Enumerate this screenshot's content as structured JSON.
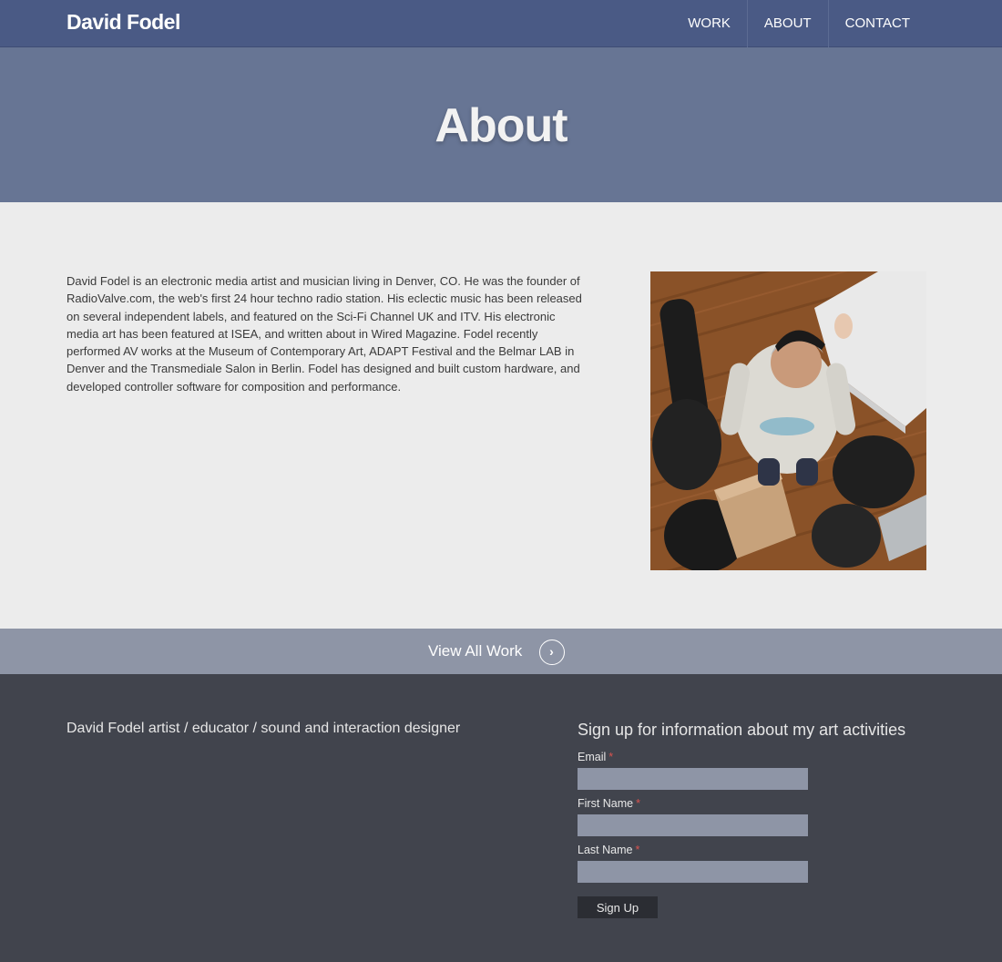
{
  "header": {
    "brand": "David Fodel",
    "nav": [
      "WORK",
      "ABOUT",
      "CONTACT"
    ]
  },
  "hero": {
    "title": "About"
  },
  "main": {
    "bio": "David Fodel is an electronic media artist and musician living in Denver, CO. He was the founder of RadioValve.com, the web's first 24 hour techno radio station. His eclectic music has been released on several independent labels, and featured on the Sci-Fi Channel UK and ITV. His electronic media art has been featured at ISEA, and written about in Wired Magazine. Fodel recently performed AV works at the Museum of Contemporary Art, ADAPT Festival and the Belmar LAB in Denver and the Transmediale Salon in Berlin. Fodel has designed and built custom hardware, and developed controller software for composition and performance.",
    "photo_icon": "portrait-photo"
  },
  "workbar": {
    "label": "View All Work",
    "icon": "chevron-right-circle-icon"
  },
  "footer": {
    "tagline": "David Fodel artist / educator / sound and interaction designer",
    "signup": {
      "heading": "Sign up for information about my art activities",
      "required_mark": "*",
      "fields": [
        {
          "label": "Email",
          "value": ""
        },
        {
          "label": "First Name",
          "value": ""
        },
        {
          "label": "Last Name",
          "value": ""
        }
      ],
      "button": "Sign Up"
    }
  },
  "colors": {
    "header": "#4a5a85",
    "hero": "#677594",
    "workbar": "#8e95a6",
    "footer": "#41444d",
    "required": "#d9534f"
  }
}
